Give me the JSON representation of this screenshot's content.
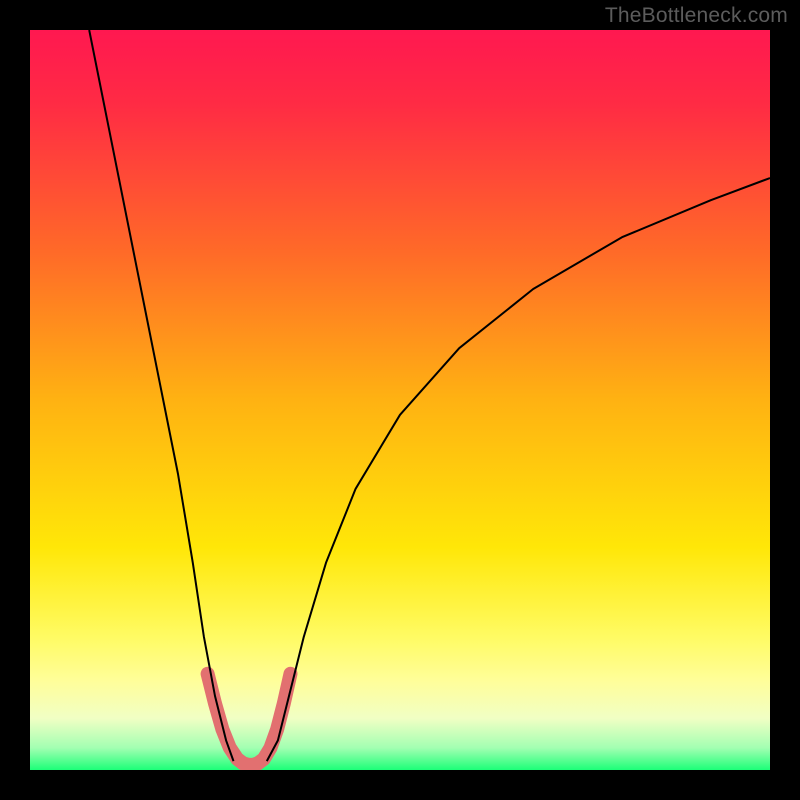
{
  "watermark": "TheBottleneck.com",
  "chart_data": {
    "type": "line",
    "title": "",
    "xlabel": "",
    "ylabel": "",
    "xlim": [
      0,
      100
    ],
    "ylim": [
      0,
      100
    ],
    "background_gradient": {
      "direction": "vertical",
      "stops": [
        {
          "pos": 0.0,
          "color": "#ff1850"
        },
        {
          "pos": 0.1,
          "color": "#ff2b44"
        },
        {
          "pos": 0.3,
          "color": "#ff6a28"
        },
        {
          "pos": 0.5,
          "color": "#ffb212"
        },
        {
          "pos": 0.7,
          "color": "#ffe708"
        },
        {
          "pos": 0.82,
          "color": "#fffb63"
        },
        {
          "pos": 0.88,
          "color": "#fffe9a"
        },
        {
          "pos": 0.93,
          "color": "#f1ffc4"
        },
        {
          "pos": 0.97,
          "color": "#a3ffb2"
        },
        {
          "pos": 1.0,
          "color": "#1cff78"
        }
      ]
    },
    "series": [
      {
        "name": "curve-left",
        "stroke": "#000000",
        "stroke_width": 2,
        "x": [
          8,
          10,
          12,
          14,
          16,
          18,
          20,
          22,
          23.5,
          25,
          26.5,
          27.5
        ],
        "y": [
          100,
          90,
          80,
          70,
          60,
          50,
          40,
          28,
          18,
          10,
          4,
          1.2
        ]
      },
      {
        "name": "curve-right",
        "stroke": "#000000",
        "stroke_width": 2,
        "x": [
          32,
          33.5,
          35,
          37,
          40,
          44,
          50,
          58,
          68,
          80,
          92,
          100
        ],
        "y": [
          1.2,
          4,
          10,
          18,
          28,
          38,
          48,
          57,
          65,
          72,
          77,
          80
        ]
      },
      {
        "name": "trough-highlight-left",
        "stroke": "#e27070",
        "stroke_width": 14,
        "linecap": "round",
        "x": [
          24.0,
          25.0,
          26.0,
          27.0,
          28.0,
          28.8
        ],
        "y": [
          13.0,
          9.0,
          5.5,
          3.0,
          1.5,
          0.9
        ]
      },
      {
        "name": "trough-highlight-bottom",
        "stroke": "#e27070",
        "stroke_width": 14,
        "linecap": "round",
        "x": [
          28.8,
          29.5,
          30.2,
          30.8
        ],
        "y": [
          0.9,
          0.7,
          0.7,
          0.9
        ]
      },
      {
        "name": "trough-highlight-right",
        "stroke": "#e27070",
        "stroke_width": 14,
        "linecap": "round",
        "x": [
          30.8,
          31.6,
          32.5,
          33.4,
          34.3,
          35.2
        ],
        "y": [
          0.9,
          1.5,
          3.0,
          5.5,
          9.0,
          13.0
        ]
      }
    ]
  }
}
